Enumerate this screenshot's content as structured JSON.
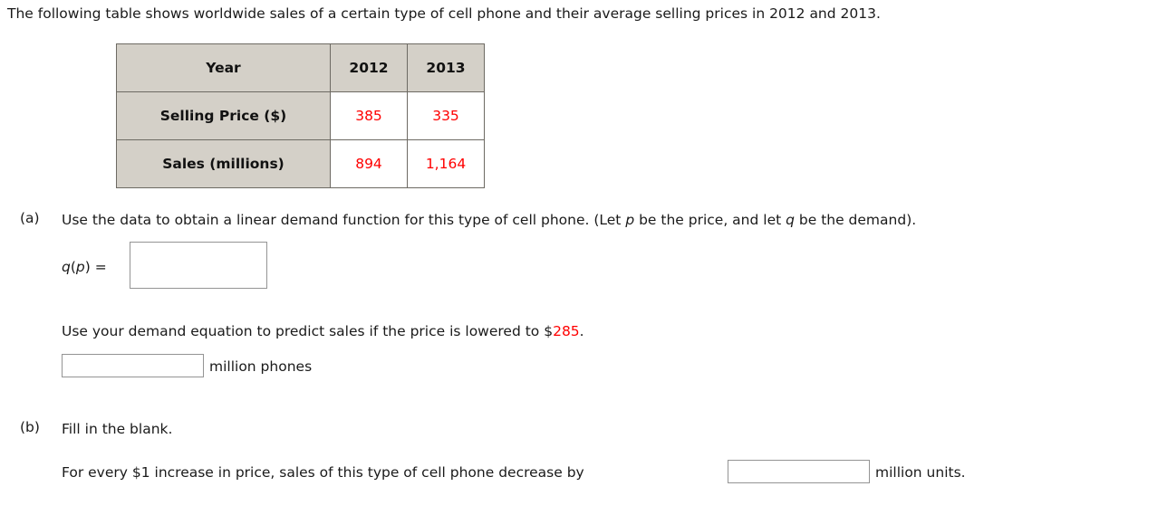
{
  "intro": "The following table shows worldwide sales of a certain type of cell phone and their average selling prices in 2012 and 2013.",
  "table": {
    "header": {
      "row_label": "Year",
      "columns": [
        "2012",
        "2013"
      ]
    },
    "rows": [
      {
        "label": "Selling Price ($)",
        "values": [
          "385",
          "335"
        ]
      },
      {
        "label": "Sales (millions)",
        "values": [
          "894",
          "1,164"
        ]
      }
    ],
    "colors": {
      "label_background": "#d4d0c8",
      "value_text": "#ff0000",
      "border": "#6d6a63"
    }
  },
  "parts": {
    "a": {
      "label": "(a)",
      "prompt_plain": "Use the data to obtain a linear demand function for this type of cell phone. (Let ",
      "prompt_var1": "p",
      "prompt_mid": " be the price, and let ",
      "prompt_var2": "q",
      "prompt_end": " be the demand).",
      "function_label_1": "q",
      "function_label_2": "(",
      "function_label_3": "p",
      "function_label_4": ") =",
      "function_input_value": "",
      "function_input_placeholder": "",
      "predict_text_1": "Use your demand equation to predict sales if the price is lowered to $",
      "predict_price": "285",
      "predict_text_2": ".",
      "predict_input_value": "",
      "predict_input_placeholder": "",
      "predict_units": "million phones"
    },
    "b": {
      "label": "(b)",
      "prompt": "Fill in the blank.",
      "blank_text_1": "For every $1 increase in price, sales of this type of cell phone decrease by",
      "blank_input_value": "",
      "blank_input_placeholder": "",
      "blank_text_2": "million units."
    }
  }
}
